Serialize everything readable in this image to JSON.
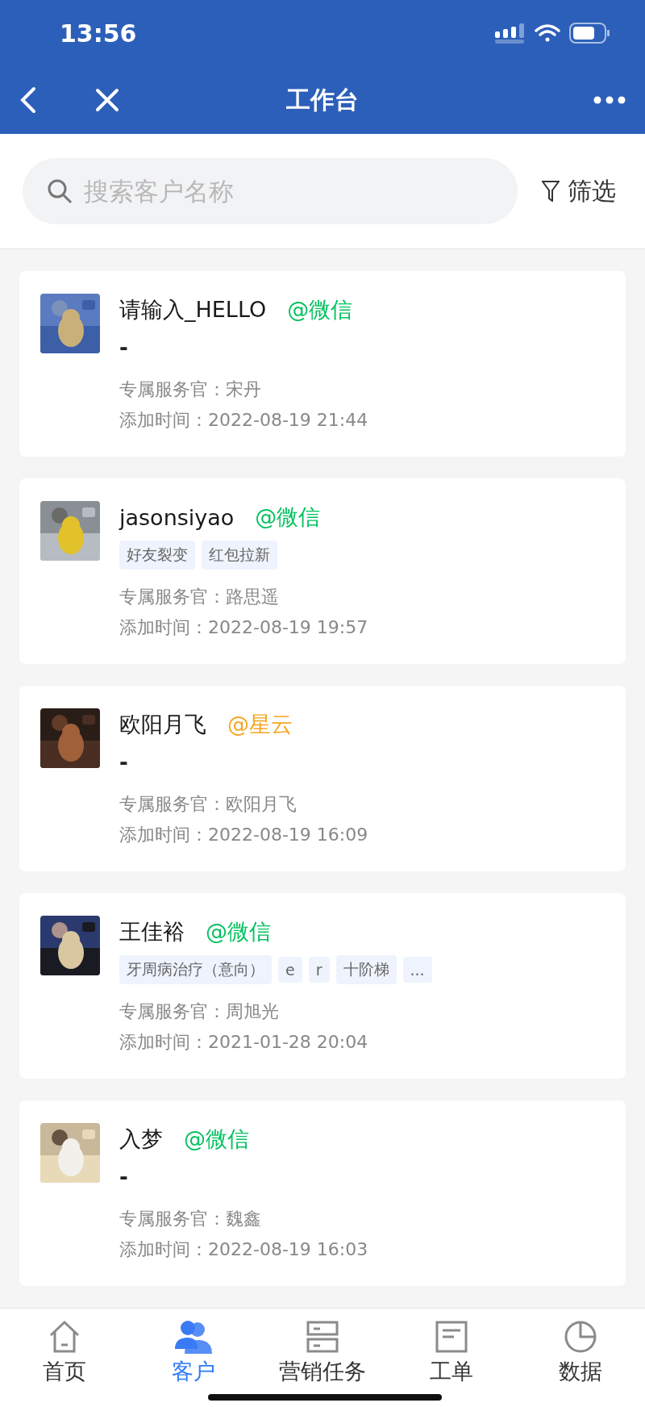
{
  "status_bar": {
    "time": "13:56"
  },
  "nav_bar": {
    "title": "工作台"
  },
  "search": {
    "placeholder": "搜索客户名称"
  },
  "filter": {
    "label": "筛选"
  },
  "customers": [
    {
      "name": "请输入_HELLO",
      "channel": "@微信",
      "color": "#07c160",
      "empty_mark": "-",
      "service": "专属服务官：宋丹",
      "added": "添加时间：2022-08-19 21:44"
    },
    {
      "name": "jasonsiyao",
      "channel": "@微信",
      "color": "#07c160",
      "tags": [
        "好友裂变",
        "红包拉新"
      ],
      "service": "专属服务官：路思遥",
      "added": "添加时间：2022-08-19 19:57"
    },
    {
      "name": "欧阳月飞",
      "channel": "@星云",
      "color": "#f5a623",
      "empty_mark": "-",
      "service": "专属服务官：欧阳月飞",
      "added": "添加时间：2022-08-19 16:09"
    },
    {
      "name": "王佳裕",
      "channel": "@微信",
      "color": "#07c160",
      "tags": [
        "牙周病治疗（意向）",
        "e",
        "r",
        "十阶梯",
        "..."
      ],
      "service": "专属服务官：周旭光",
      "added": "添加时间：2021-01-28 20:04"
    },
    {
      "name": "入梦",
      "channel": "@微信",
      "color": "#07c160",
      "empty_mark": "-",
      "service": "专属服务官：魏鑫",
      "added": "添加时间：2022-08-19 16:03"
    }
  ],
  "tab_bar": [
    {
      "label": "首页",
      "kind": "home",
      "selected": false
    },
    {
      "label": "客户",
      "kind": "people",
      "selected": true
    },
    {
      "label": "营销任务",
      "kind": "drawers",
      "selected": false
    },
    {
      "label": "工单",
      "kind": "document",
      "selected": false
    },
    {
      "label": "数据",
      "kind": "pie",
      "selected": false
    }
  ]
}
